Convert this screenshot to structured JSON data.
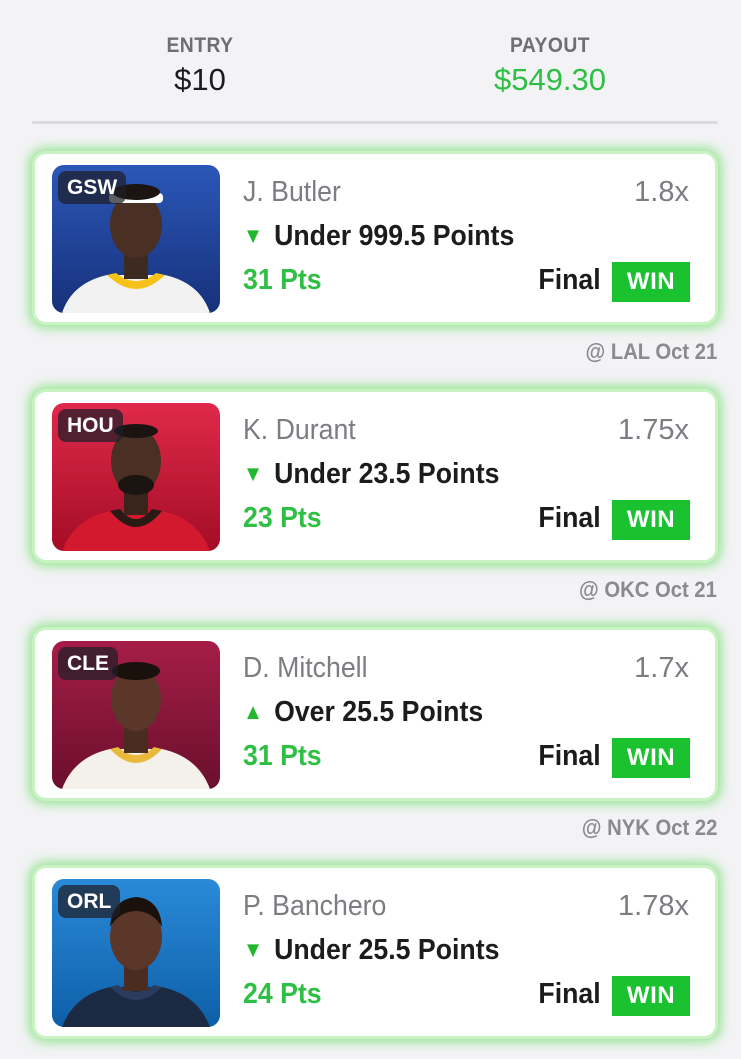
{
  "summary": {
    "entry_label": "ENTRY",
    "entry_value": "$10",
    "payout_label": "PAYOUT",
    "payout_value": "$549.30"
  },
  "colors": {
    "win_green": "#19c22e",
    "payout_green": "#2fbf44",
    "card_glow": "#5adc50"
  },
  "picks": [
    {
      "team": "GSW",
      "player": "J. Butler",
      "multiplier": "1.8x",
      "direction": "under",
      "direction_icon": "triangle-down-icon",
      "arrow": "▼",
      "line": "Under 999.5 Points",
      "result_points": "31 Pts",
      "status": "Final",
      "result": "WIN",
      "game": "@ LAL Oct 21",
      "team_color": "#1d3f94"
    },
    {
      "team": "HOU",
      "player": "K. Durant",
      "multiplier": "1.75x",
      "direction": "under",
      "direction_icon": "triangle-down-icon",
      "arrow": "▼",
      "line": "Under 23.5 Points",
      "result_points": "23 Pts",
      "status": "Final",
      "result": "WIN",
      "game": "@ OKC Oct 21",
      "team_color": "#c8102e"
    },
    {
      "team": "CLE",
      "player": "D. Mitchell",
      "multiplier": "1.7x",
      "direction": "over",
      "direction_icon": "triangle-up-icon",
      "arrow": "▲",
      "line": "Over 25.5 Points",
      "result_points": "31 Pts",
      "status": "Final",
      "result": "WIN",
      "game": "@ NYK Oct 22",
      "team_color": "#8a1538"
    },
    {
      "team": "ORL",
      "player": "P. Banchero",
      "multiplier": "1.78x",
      "direction": "under",
      "direction_icon": "triangle-down-icon",
      "arrow": "▼",
      "line": "Under 25.5 Points",
      "result_points": "24 Pts",
      "status": "Final",
      "result": "WIN",
      "team_color": "#1377c8"
    }
  ]
}
